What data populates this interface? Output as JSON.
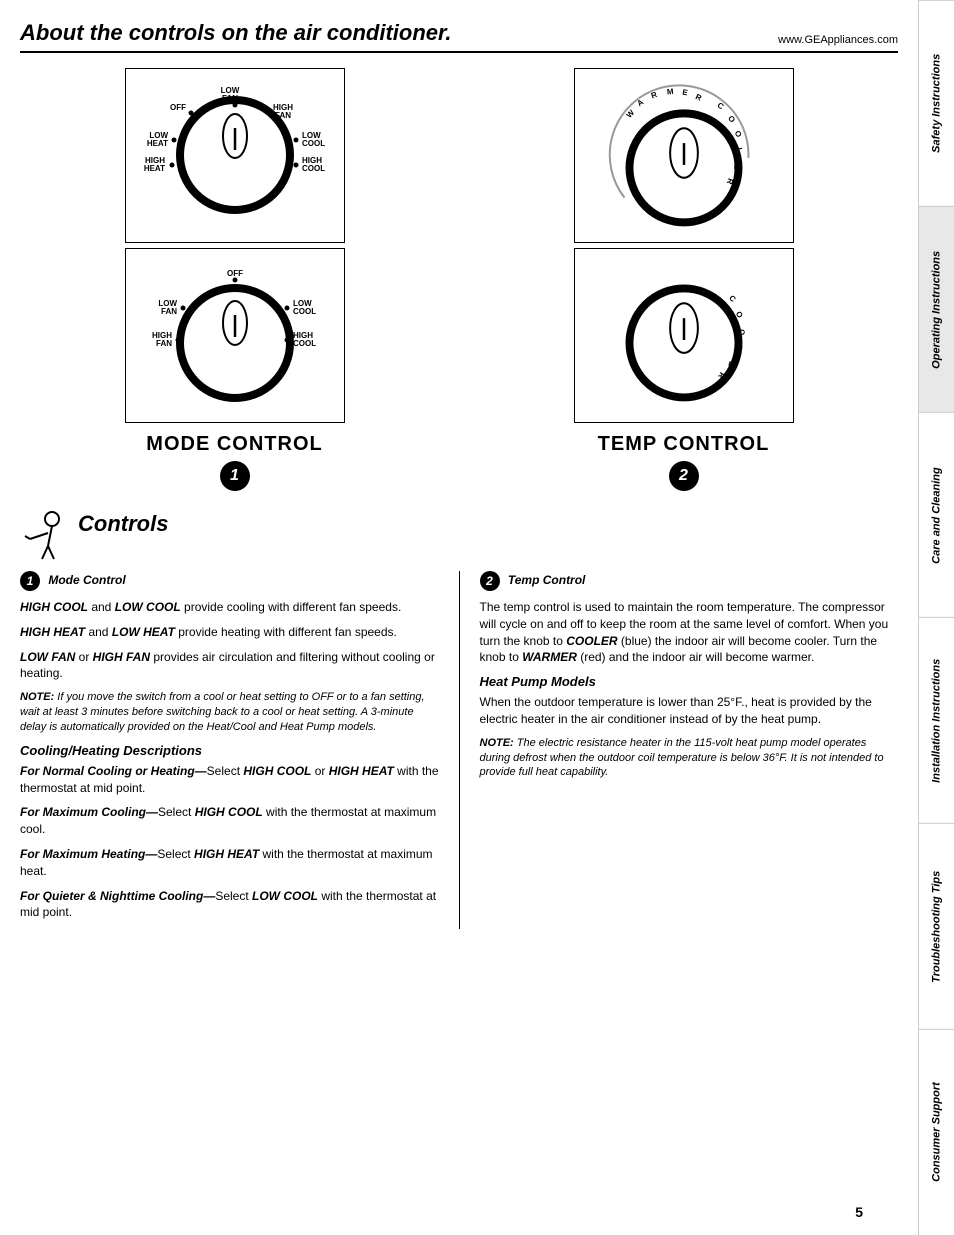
{
  "header": {
    "title": "About the controls on the air conditioner.",
    "url": "www.GEAppliances.com"
  },
  "diagrams": {
    "mode_control": {
      "label": "MODE CONTROL",
      "number": "1",
      "dial1_labels": {
        "off": "OFF",
        "low_fan": "LOW FAN",
        "high_fan": "HIGH FAN",
        "low_heat": "LOW HEAT",
        "low_cool": "LOW COOL",
        "high_heat": "HIGH HEAT",
        "high_cool": "HIGH COOL"
      },
      "dial2_labels": {
        "off": "OFF",
        "low_fan": "LOW FAN",
        "high_fan": "HIGH FAN",
        "low_cool": "LOW COOL",
        "high_cool": "HIGH COOL"
      }
    },
    "temp_control": {
      "label": "TEMP CONTROL",
      "number": "2",
      "dial1_label_warmer": "WARMER",
      "dial1_label_cooler": "COOLER",
      "dial2_label_cooler": "COOLER"
    }
  },
  "controls_section": {
    "title": "Controls",
    "left_col": {
      "section_number": "1",
      "section_title": "Mode Control",
      "para1_bold": "HIGH COOL",
      "para1_text": " and ",
      "para1_bold2": "LOW COOL",
      "para1_text2": " provide cooling with different fan speeds.",
      "para2_bold": "HIGH HEAT",
      "para2_text": " and ",
      "para2_bold2": "LOW HEAT",
      "para2_text2": " provide heating with different fan speeds.",
      "para3_bold": "LOW FAN",
      "para3_text": " or ",
      "para3_bold2": "HIGH FAN",
      "para3_text2": " provides air circulation and filtering without cooling or heating.",
      "note_label": "NOTE:",
      "note_text": " If you move the switch from a cool or heat setting to OFF or to a fan setting, wait at least 3 minutes before switching back to a cool or heat setting. A 3-minute delay is automatically provided on the Heat/Cool and Heat Pump models.",
      "cooling_heating_title": "Cooling/Heating Descriptions",
      "desc1_label": "For Normal Cooling or Heating—",
      "desc1_text": "Select ",
      "desc1_bold": "HIGH COOL",
      "desc1_text2": " or ",
      "desc1_bold2": "HIGH HEAT",
      "desc1_text3": " with the thermostat at mid point.",
      "desc2_label": "For Maximum Cooling—",
      "desc2_text": "Select ",
      "desc2_bold": "HIGH COOL",
      "desc2_text2": " with the thermostat at maximum cool.",
      "desc3_label": "For Maximum Heating—",
      "desc3_text": "Select ",
      "desc3_bold": "HIGH HEAT",
      "desc3_text2": " with the thermostat at maximum heat.",
      "desc4_label": "For Quieter & Nighttime Cooling—",
      "desc4_text": "Select ",
      "desc4_bold": "LOW COOL",
      "desc4_text2": " with the thermostat at mid point."
    },
    "right_col": {
      "section_number": "2",
      "section_title": "Temp Control",
      "para1": "The temp control is used to maintain the room temperature. The compressor will cycle on and off to keep the room at the same level of comfort. When you turn the knob to ",
      "para1_bold": "COOLER",
      "para1_text2": " (blue) the indoor air will become cooler. Turn the knob to ",
      "para1_bold2": "WARMER",
      "para1_text3": " (red) and the indoor air will become warmer.",
      "heat_pump_title": "Heat Pump Models",
      "heat_pump_para": "When the outdoor temperature is lower than 25°F., heat is provided by the electric heater in the air conditioner instead of by the heat pump.",
      "note_label": "NOTE:",
      "note_text": " The electric resistance heater in the 115-volt heat pump model operates during defrost when the outdoor coil temperature is below 36°F. It is not intended to provide full heat capability."
    }
  },
  "sidebar": {
    "tabs": [
      "Safety Instructions",
      "Operating Instructions",
      "Care and Cleaning",
      "Installation Instructions",
      "Troubleshooting Tips",
      "Consumer Support"
    ]
  },
  "page_number": "5"
}
